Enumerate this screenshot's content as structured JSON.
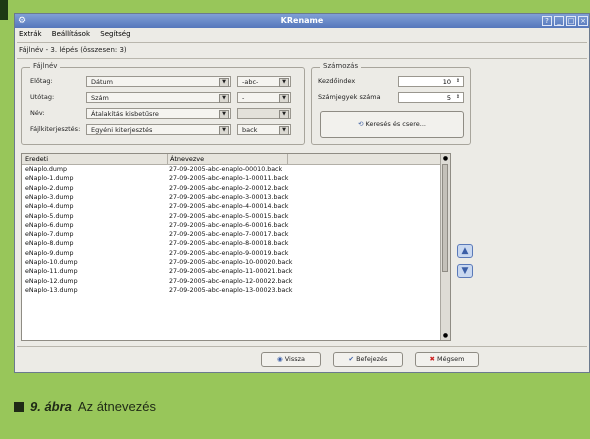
{
  "window": {
    "title": "KRename",
    "controls": [
      "?",
      "_",
      "□",
      "×"
    ]
  },
  "menu": [
    "Extrák",
    "Beállítások",
    "Segítség"
  ],
  "step_label": "Fájlnév - 3. lépés (összesen: 3)",
  "filename_group": {
    "legend": "Fájlnév",
    "rows": [
      {
        "label": "Előtag:",
        "value": "Dátum",
        "extra": "-abc-"
      },
      {
        "label": "Utótag:",
        "value": "Szám",
        "extra": "-"
      },
      {
        "label": "Név:",
        "value": "Átalakítás kisbetűsre",
        "extra": ""
      },
      {
        "label": "Fájlkiterjesztés:",
        "value": "Egyéni kiterjesztés",
        "extra": "back"
      }
    ]
  },
  "numbering_group": {
    "legend": "Számozás",
    "start_label": "Kezdőindex",
    "start_value": "10",
    "digits_label": "Számjegyek száma",
    "digits_value": "5"
  },
  "find_replace_label": "Keresés és csere...",
  "table": {
    "columns": [
      "Eredeti",
      "Átnevezve"
    ],
    "rows": [
      [
        "eNaplo.dump",
        "27-09-2005-abc-enaplo-00010.back"
      ],
      [
        "eNaplo-1.dump",
        "27-09-2005-abc-enaplo-1-00011.back"
      ],
      [
        "eNaplo-2.dump",
        "27-09-2005-abc-enaplo-2-00012.back"
      ],
      [
        "eNaplo-3.dump",
        "27-09-2005-abc-enaplo-3-00013.back"
      ],
      [
        "eNaplo-4.dump",
        "27-09-2005-abc-enaplo-4-00014.back"
      ],
      [
        "eNaplo-5.dump",
        "27-09-2005-abc-enaplo-5-00015.back"
      ],
      [
        "eNaplo-6.dump",
        "27-09-2005-abc-enaplo-6-00016.back"
      ],
      [
        "eNaplo-7.dump",
        "27-09-2005-abc-enaplo-7-00017.back"
      ],
      [
        "eNaplo-8.dump",
        "27-09-2005-abc-enaplo-8-00018.back"
      ],
      [
        "eNaplo-9.dump",
        "27-09-2005-abc-enaplo-9-00019.back"
      ],
      [
        "eNaplo-10.dump",
        "27-09-2005-abc-enaplo-10-00020.back"
      ],
      [
        "eNaplo-11.dump",
        "27-09-2005-abc-enaplo-11-00021.back"
      ],
      [
        "eNaplo-12.dump",
        "27-09-2005-abc-enaplo-12-00022.back"
      ],
      [
        "eNaplo-13.dump",
        "27-09-2005-abc-enaplo-13-00023.back"
      ]
    ]
  },
  "buttons": {
    "back": "Vissza",
    "finish": "Befejezés",
    "cancel": "Mégsem"
  },
  "caption": {
    "number": "9. ábra",
    "text": "Az átnevezés"
  },
  "colors": {
    "page_bg": "#98c65a",
    "titlebar": "#6a8cc8",
    "window_bg": "#ecebe6"
  }
}
